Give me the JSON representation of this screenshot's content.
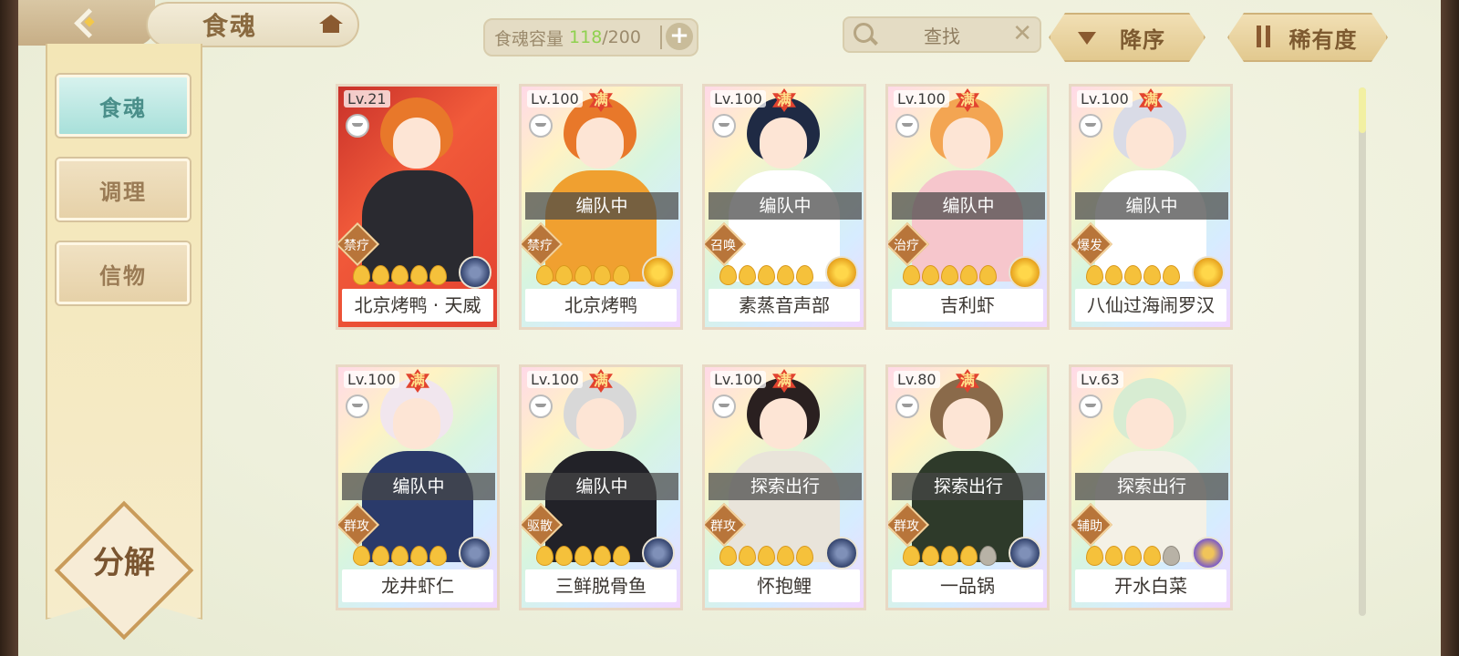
{
  "header": {
    "title": "食魂",
    "capacity_label": "食魂容量",
    "capacity_current": "118",
    "capacity_max": "/200",
    "capacity_add": "+",
    "search_placeholder": "查找",
    "close_symbol": "✕",
    "sort_label": "降序",
    "rarity_label": "稀有度"
  },
  "sidebar": {
    "items": [
      {
        "label": "食魂",
        "active": true
      },
      {
        "label": "调理",
        "active": false
      },
      {
        "label": "信物",
        "active": false
      }
    ],
    "decompose_label": "分解"
  },
  "cards": [
    {
      "name": "北京烤鸭 · 天威",
      "level": "Lv.21",
      "maxed": false,
      "status": "",
      "role": "禁疗",
      "stars_filled": 5,
      "emblem": "blue",
      "frame": "red",
      "hair": "#e8782a",
      "outfit": "#2a2a30"
    },
    {
      "name": "北京烤鸭",
      "level": "Lv.100",
      "maxed": true,
      "status": "编队中",
      "role": "禁疗",
      "stars_filled": 5,
      "emblem": "gold",
      "frame": "rainbow",
      "hair": "#e8782a",
      "outfit": "#f0a030"
    },
    {
      "name": "素蒸音声部",
      "level": "Lv.100",
      "maxed": true,
      "status": "编队中",
      "role": "召唤",
      "stars_filled": 5,
      "emblem": "gold",
      "frame": "rainbow",
      "hair": "#1f2a44",
      "outfit": "#ffffff"
    },
    {
      "name": "吉利虾",
      "level": "Lv.100",
      "maxed": true,
      "status": "编队中",
      "role": "治疗",
      "stars_filled": 5,
      "emblem": "gold",
      "frame": "rainbow",
      "hair": "#f3a552",
      "outfit": "#f6c6cc"
    },
    {
      "name": "八仙过海闹罗汉",
      "level": "Lv.100",
      "maxed": true,
      "status": "编队中",
      "role": "爆发",
      "stars_filled": 5,
      "emblem": "gold",
      "frame": "rainbow",
      "hair": "#d9dbe6",
      "outfit": "#ffffff"
    },
    {
      "name": "龙井虾仁",
      "level": "Lv.100",
      "maxed": true,
      "status": "编队中",
      "role": "群攻",
      "stars_filled": 5,
      "emblem": "blue",
      "frame": "rainbow",
      "hair": "#f1e6ee",
      "outfit": "#2a3a6a"
    },
    {
      "name": "三鲜脱骨鱼",
      "level": "Lv.100",
      "maxed": true,
      "status": "编队中",
      "role": "驱散",
      "stars_filled": 5,
      "emblem": "blue",
      "frame": "rainbow",
      "hair": "#d8d8d8",
      "outfit": "#222228"
    },
    {
      "name": "怀抱鲤",
      "level": "Lv.100",
      "maxed": true,
      "status": "探索出行",
      "role": "群攻",
      "stars_filled": 5,
      "emblem": "blue",
      "frame": "rainbow",
      "hair": "#2a2020",
      "outfit": "#e9e4da"
    },
    {
      "name": "一品锅",
      "level": "Lv.80",
      "maxed": true,
      "status": "探索出行",
      "role": "群攻",
      "stars_filled": 4,
      "emblem": "blue",
      "frame": "rainbow",
      "hair": "#8a6a4a",
      "outfit": "#2e3a2a"
    },
    {
      "name": "开水白菜",
      "level": "Lv.63",
      "maxed": false,
      "status": "探索出行",
      "role": "辅助",
      "stars_filled": 4,
      "emblem": "purple",
      "frame": "rainbow",
      "hair": "#d7ecd2",
      "outfit": "#f4f1e6"
    }
  ],
  "colors": {
    "capacity_current": "#8fd14f",
    "maxed_badge": "#e2432f",
    "active_tab": "#a8e0da"
  }
}
